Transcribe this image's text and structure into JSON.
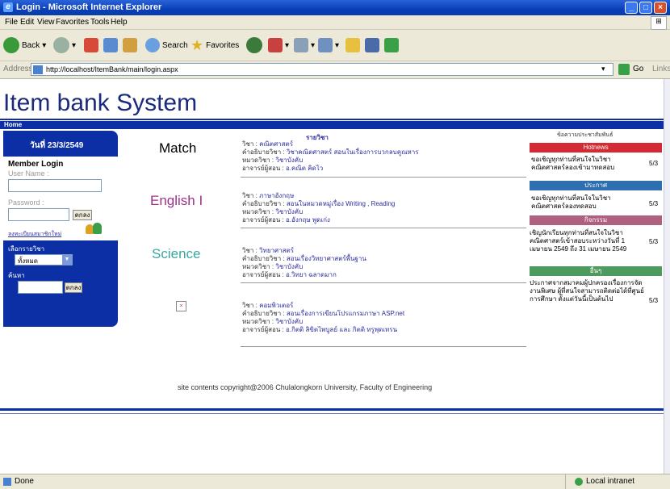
{
  "window": {
    "title": "Login - Microsoft Internet Explorer"
  },
  "menu": [
    "File",
    "Edit",
    "View",
    "Favorites",
    "Tools",
    "Help"
  ],
  "toolbar": {
    "back": "Back",
    "search": "Search",
    "favorites": "Favorites"
  },
  "address": {
    "label": "Address",
    "url": "http://localhost/ItemBank/main/login.aspx",
    "go": "Go",
    "links": "Links"
  },
  "page": {
    "title": "Item bank System",
    "nav_home": "Home",
    "date": "วันที่ 23/3/2549",
    "login": {
      "heading": "Member Login",
      "user_label": "User Name :",
      "password_label": "Password :",
      "login_button": "ตกลง",
      "register_link": "ลงทะเบียนสมาชิกใหม่"
    },
    "search": {
      "subject_label": "เลือกรายวิชา",
      "subject_value": "ทั้งหมด",
      "keyword_label": "ค้นหา",
      "search_button": "ตกลง"
    },
    "courses_heading": "รายวิชา",
    "courses": [
      {
        "name": "Match",
        "color": "#1b2a7a",
        "lines": [
          [
            "วิชา :",
            "คณิตศาสตร์"
          ],
          [
            "คำอธิบายวิชา :",
            "วิชาคณิตศาสตร์ สอนในเรื่องการบวกลบคูณหาร"
          ],
          [
            "หมวดวิชา :",
            "วิชาบังคับ"
          ],
          [
            "อาจารย์ผู้สอน :",
            "อ.คณิต คิดไว"
          ]
        ]
      },
      {
        "name": "English I",
        "color": "#a0308a",
        "lines": [
          [
            "วิชา :",
            "ภาษาอังกฤษ"
          ],
          [
            "คำอธิบายวิชา :",
            "สอนในหมวดหมู่เรื่อง Writing , Reading"
          ],
          [
            "หมวดวิชา :",
            "วิชาบังคับ"
          ],
          [
            "อาจารย์ผู้สอน :",
            "อ.อังกฤษ พูดเก่ง"
          ]
        ]
      },
      {
        "name": "Science",
        "color": "#3aa6a0",
        "lines": [
          [
            "วิชา :",
            "วิทยาศาสตร์"
          ],
          [
            "คำอธิบายวิชา :",
            "สอนเรื่องวิทยาศาสตร์พื้นฐาน"
          ],
          [
            "หมวดวิชา :",
            "วิชาบังคับ"
          ],
          [
            "อาจารย์ผู้สอน :",
            "อ.วิทยา ฉลาดมาก"
          ]
        ]
      },
      {
        "name": "",
        "color": "#000000",
        "lines": [
          [
            "วิชา :",
            "คอมพิวเตอร์"
          ],
          [
            "คำอธิบายวิชา :",
            "สอนเรื่องการเขียนโปรแกรมภาษา ASP.net"
          ],
          [
            "หมวดวิชา :",
            "วิชาบังคับ"
          ],
          [
            "อาจารย์ผู้สอน :",
            "อ.กิตติ ลิขิตไพบูลย์ และ กิตติ ทรูพุดเทรน"
          ]
        ]
      }
    ],
    "news_heading": "ข้อความประชาสัมพันธ์",
    "news": [
      {
        "header": "Hotnews",
        "color": "#d42a34",
        "text": "ขอเชิญทุกท่านที่สนใจในวิชาคณิตศาสตร์ลองเข้ามาทดสอบ",
        "date": "5/3"
      },
      {
        "header": "ประกาศ",
        "color": "#2f6fb0",
        "text": "ขอเชิญทุกท่านที่สนใจในวิชาคณิตศาสตร์ลองทดสอบ",
        "date": "5/3"
      },
      {
        "header": "กิจกรรม",
        "color": "#b0607f",
        "text": "เชิญนักเรียนทุกท่านที่สนใจในวิชาคณิตศาสตร์เข้าสอบระหว่างวันที่ 1 เมษายน 2549 ถึง 31 เมษายน 2549",
        "date": "5/3"
      },
      {
        "header": "อื่นๆ",
        "color": "#4d9a5e",
        "text": "ประกาศจากสมาคมผู้ปกครองเรื่องการจัดงานพิเศษ ผู้ที่สนใจสามารถติดต่อได้ที่ศูนย์การศึกษา ตั้งแต่วันนี้เป็นต้นไป",
        "date": "5/3"
      }
    ],
    "footer": "site contents copyright@2006 Chulalongkorn University, Faculty of Engineering"
  },
  "status": {
    "left": "Done",
    "right": "Local intranet"
  }
}
